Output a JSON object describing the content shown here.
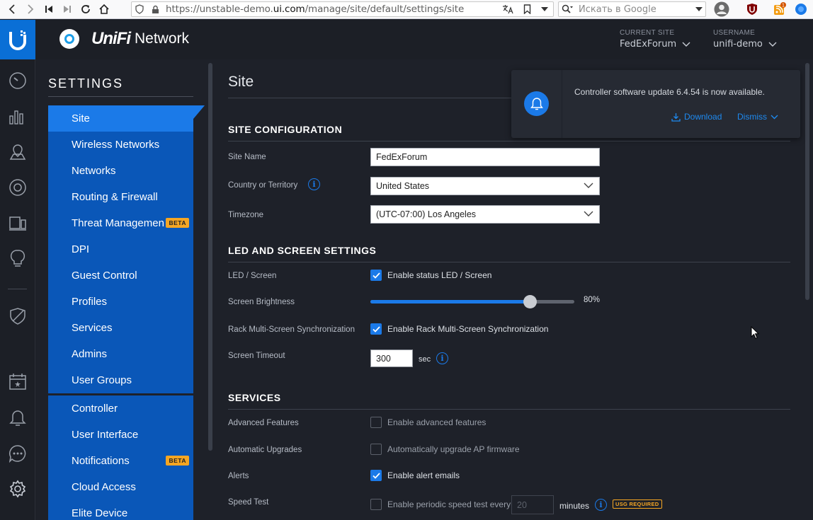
{
  "browser": {
    "url_prefix": "https://unstable-demo.",
    "url_domain": "ui.com",
    "url_path": "/manage/site/default/settings/site",
    "search_placeholder": "Искать в Google",
    "ext_badge": "1"
  },
  "header": {
    "brand_unifi": "UniFi",
    "brand_network": "Network",
    "current_site_label": "CURRENT SITE",
    "current_site_value": "FedExForum",
    "username_label": "USERNAME",
    "username_value": "unifi-demo"
  },
  "rail": {
    "icons": [
      "unifi-logo-icon",
      "dashboard-icon",
      "statistics-icon",
      "map-icon",
      "devices-icon",
      "clients-icon",
      "insights-icon",
      "security-icon",
      "events-icon",
      "alerts-icon",
      "chat-icon",
      "settings-icon"
    ]
  },
  "sidebar": {
    "title": "SETTINGS",
    "beta_label": "BETA",
    "items": [
      {
        "label": "Site",
        "active": true
      },
      {
        "label": "Wireless Networks"
      },
      {
        "label": "Networks"
      },
      {
        "label": "Routing & Firewall"
      },
      {
        "label": "Threat Managemen"
      },
      {
        "label": "DPI"
      },
      {
        "label": "Guest Control"
      },
      {
        "label": "Profiles"
      },
      {
        "label": "Services"
      },
      {
        "label": "Admins"
      },
      {
        "label": "User Groups"
      }
    ],
    "items2": [
      {
        "label": "Controller"
      },
      {
        "label": "User Interface"
      },
      {
        "label": "Notifications"
      },
      {
        "label": "Cloud Access"
      },
      {
        "label": "Elite Device"
      }
    ]
  },
  "main": {
    "title": "Site",
    "site_config": {
      "heading": "SITE CONFIGURATION",
      "site_name_label": "Site Name",
      "site_name_value": "FedExForum",
      "country_label": "Country or Territory",
      "country_value": "United States",
      "timezone_label": "Timezone",
      "timezone_value": "(UTC-07:00) Los Angeles"
    },
    "led": {
      "heading": "LED AND SCREEN SETTINGS",
      "led_label": "LED / Screen",
      "led_check": "Enable status LED / Screen",
      "brightness_label": "Screen Brightness",
      "brightness_value": "80%",
      "brightness_fraction": 0.78,
      "rack_label": "Rack Multi-Screen Synchronization",
      "rack_check": "Enable Rack Multi-Screen Synchronization",
      "timeout_label": "Screen Timeout",
      "timeout_value": "300",
      "timeout_unit": "sec"
    },
    "services": {
      "heading": "SERVICES",
      "adv_label": "Advanced Features",
      "adv_check": "Enable advanced features",
      "upg_label": "Automatic Upgrades",
      "upg_check": "Automatically upgrade AP firmware",
      "alerts_label": "Alerts",
      "alerts_check": "Enable alert emails",
      "speed_label": "Speed Test",
      "speed_check": "Enable periodic speed test every",
      "speed_value": "20",
      "speed_unit": "minutes",
      "usg_badge": "USG REQUIRED"
    }
  },
  "notification": {
    "message": "Controller software update 6.4.54 is now available.",
    "download": "Download",
    "dismiss": "Dismiss"
  },
  "colors": {
    "accent": "#1b7ae8",
    "menu_bg": "#0a57b8",
    "beta": "#f5a623",
    "background": "#1e2129"
  }
}
